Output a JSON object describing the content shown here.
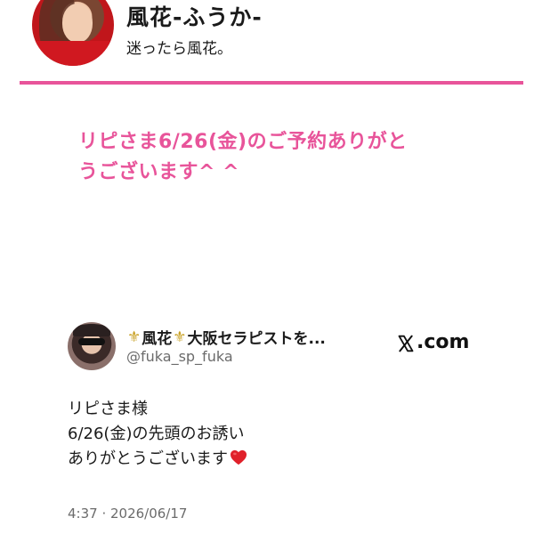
{
  "profile": {
    "name": "風花-ふうか-",
    "tagline": "迷ったら風花。",
    "avatar_icon": "profile-photo"
  },
  "message": {
    "line1": "リピさま6/26(金)のご予約ありがと",
    "line2": "うございます^ ^"
  },
  "post": {
    "display_name_part1": "風花",
    "display_name_part2": "大阪セラピストを...",
    "handle": "@fuka_sp_fuka",
    "site_label": ".com",
    "body": {
      "line1": "リピさま様",
      "line2": "6/26(金)の先頭のお誘い",
      "line3": "ありがとうございます"
    },
    "timestamp": "4:37 · 2026/06/17"
  },
  "colors": {
    "accent_pink": "#e8549a",
    "heart_red": "#e0202a",
    "fleur_gold": "#c9a227"
  }
}
